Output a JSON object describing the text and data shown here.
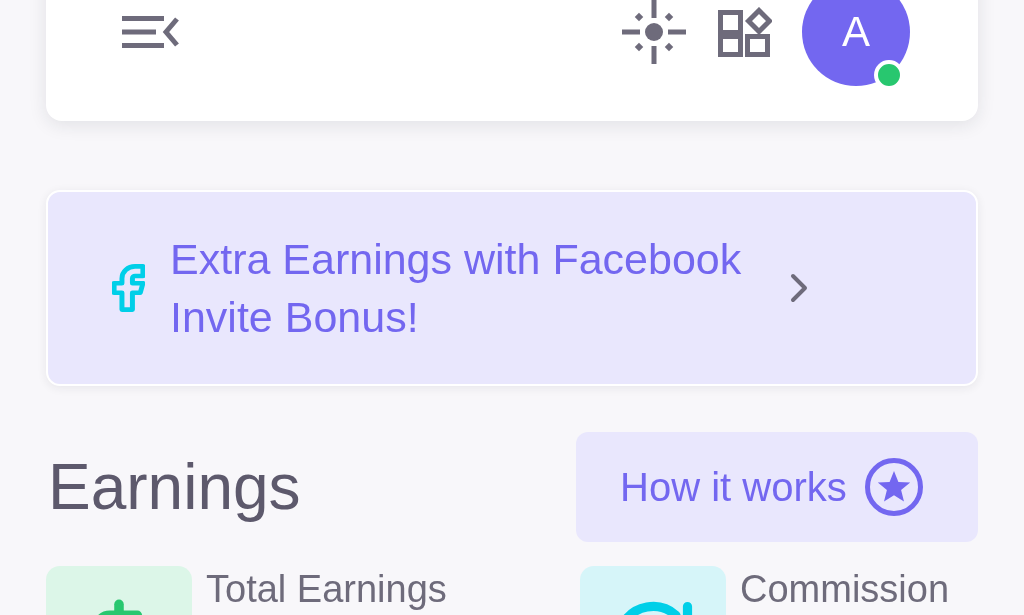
{
  "header": {
    "avatar": {
      "initial": "A",
      "online": true
    }
  },
  "banner": {
    "text": "Extra Earnings with Facebook Invite Bonus!"
  },
  "earnings": {
    "title": "Earnings",
    "help_button": {
      "label": "How it works"
    },
    "stats": [
      {
        "kind": "dollar",
        "label": "Total Earnings"
      },
      {
        "kind": "history",
        "label": "Commission"
      }
    ]
  }
}
